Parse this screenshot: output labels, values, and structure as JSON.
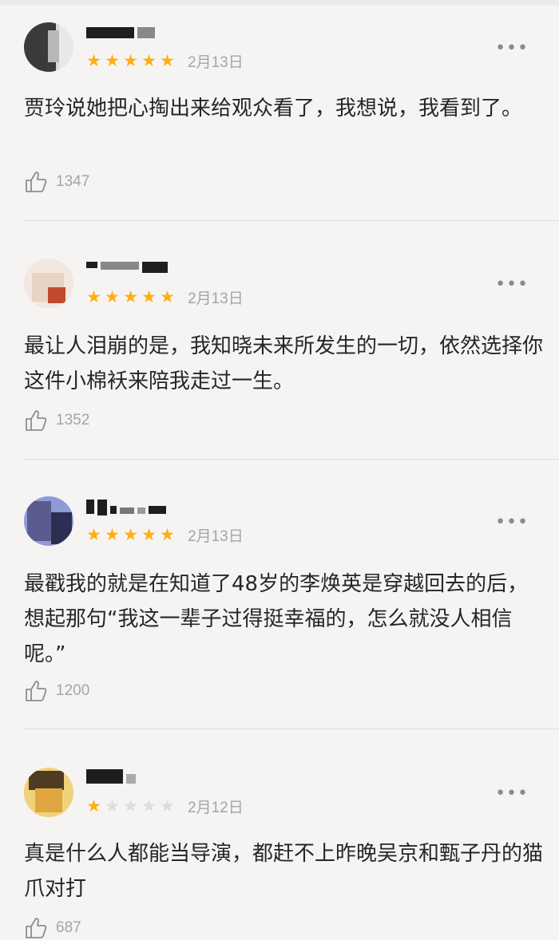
{
  "comments": [
    {
      "stars": [
        true,
        true,
        true,
        true,
        true
      ],
      "date": "2月13日",
      "text": "贾玲说她把心掏出来给观众看了，我想说，我看到了。",
      "likes": "1347",
      "more": "•••",
      "colors": {
        "av1": "#3a3a3a",
        "av2": "#b8b8b8",
        "av3": "#e8e8e8"
      }
    },
    {
      "stars": [
        true,
        true,
        true,
        true,
        true
      ],
      "date": "2月13日",
      "text": "最让人泪崩的是，我知晓未来所发生的一切，依然选择你这件小棉袄来陪我走过一生。",
      "likes": "1352",
      "more": "•••",
      "colors": {
        "av1": "#e9d3c5",
        "av2": "#c24a2f",
        "av3": "#f3e8e1"
      }
    },
    {
      "stars": [
        true,
        true,
        true,
        true,
        true
      ],
      "date": "2月13日",
      "text": "最戳我的就是在知道了48岁的李焕英是穿越回去的后，想起那句“我这一辈子过得挺幸福的，怎么就没人相信呢。”",
      "likes": "1200",
      "more": "•••",
      "colors": {
        "av1": "#5a5c8f",
        "av2": "#8e9bd6",
        "av3": "#2d2f52"
      }
    },
    {
      "stars": [
        true,
        false,
        false,
        false,
        false
      ],
      "date": "2月12日",
      "text": "真是什么人都能当导演，都赶不上昨晚吴京和甄子丹的猫爪对打",
      "likes": "687",
      "more": "•••",
      "colors": {
        "av1": "#4e3b22",
        "av2": "#e0a640",
        "av3": "#f0d27a"
      }
    }
  ]
}
